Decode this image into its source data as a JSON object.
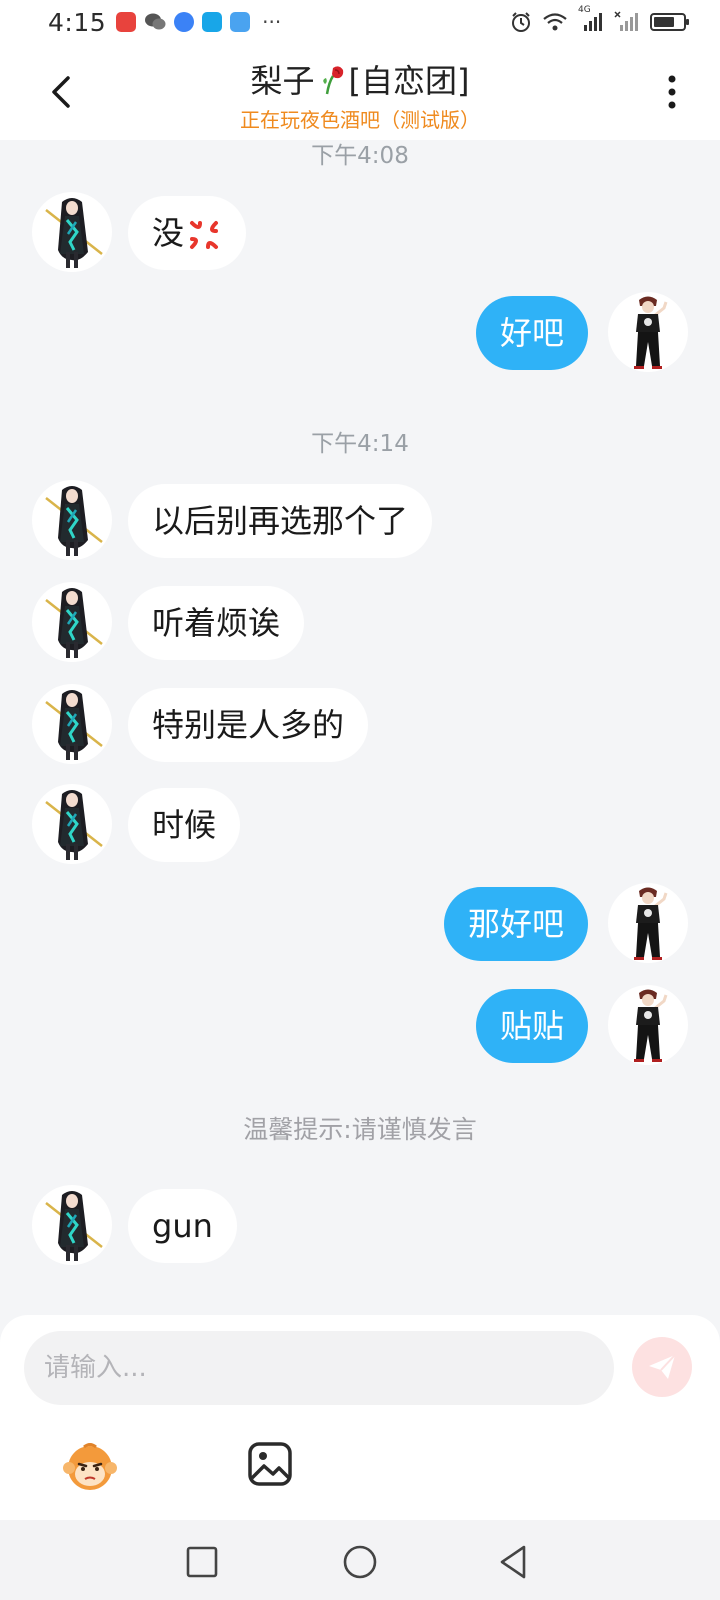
{
  "status_bar": {
    "time": "4:15",
    "network_label": "4G",
    "battery_level": 0.72
  },
  "header": {
    "title": "梨子",
    "title_tag": "[自恋团]",
    "subtitle": "正在玩夜色酒吧（测试版）"
  },
  "chat": {
    "time_1": "下午4:08",
    "time_2": "下午4:14",
    "messages": [
      {
        "side": "left",
        "text": "没"
      },
      {
        "side": "right",
        "text": "好吧"
      },
      {
        "side": "left",
        "text": "以后别再选那个了"
      },
      {
        "side": "left",
        "text": "听着烦诶"
      },
      {
        "side": "left",
        "text": "特别是人多的"
      },
      {
        "side": "left",
        "text": "时候"
      },
      {
        "side": "right",
        "text": "那好吧"
      },
      {
        "side": "right",
        "text": "贴贴"
      },
      {
        "side": "left",
        "text": "gun"
      }
    ],
    "tip": "温馨提示:请谨慎发言"
  },
  "input": {
    "placeholder": "请输入..."
  },
  "colors": {
    "accent_blue": "#2fb2f7",
    "subtitle_orange": "#ef8a1e",
    "send_pink": "#fde1e1"
  },
  "icons": {
    "back": "chevron-left-icon",
    "more": "more-vertical-icon",
    "send": "paper-plane-icon",
    "emoji": "monkey-emoji-icon",
    "image": "image-icon",
    "nav_recent": "square-icon",
    "nav_home": "circle-icon",
    "nav_back": "triangle-back-icon"
  }
}
